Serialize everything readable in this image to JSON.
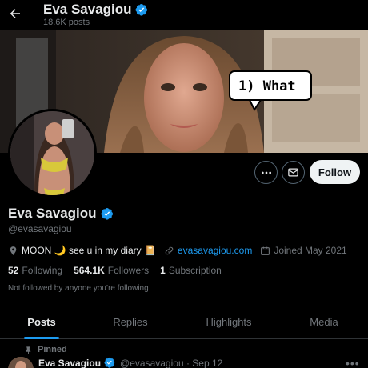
{
  "header": {
    "title": "Eva Savagiou",
    "post_count": "18.6K posts"
  },
  "banner": {
    "sticker_text": "1) What"
  },
  "actions": {
    "follow_label": "Follow"
  },
  "profile": {
    "name": "Eva Savagiou",
    "handle": "@evasavagiou",
    "bio": "MOON 🌙 see u in my diary 📔",
    "website": "evasavagiou.com",
    "joined": "Joined May 2021",
    "following_count": "52",
    "following_label": "Following",
    "followers_count": "564.1K",
    "followers_label": "Followers",
    "subscription_count": "1",
    "subscription_label": "Subscription",
    "not_followed_text": "Not followed by anyone you’re following"
  },
  "tabs": [
    {
      "label": "Posts",
      "active": true
    },
    {
      "label": "Replies",
      "active": false
    },
    {
      "label": "Highlights",
      "active": false
    },
    {
      "label": "Media",
      "active": false
    }
  ],
  "pinned_post": {
    "pinned_label": "Pinned",
    "author": "Eva Savagiou",
    "handle_date": "@evasavagiou · Sep 12"
  },
  "colors": {
    "background": "#000000",
    "text_primary": "#e7e9ea",
    "text_secondary": "#71767b",
    "accent": "#1d9bf0",
    "follow_button_bg": "#eff3f4"
  },
  "icons": [
    "back-arrow-icon",
    "verified-badge-icon",
    "more-icon",
    "message-icon",
    "location-icon",
    "link-icon",
    "calendar-icon",
    "pin-icon"
  ]
}
